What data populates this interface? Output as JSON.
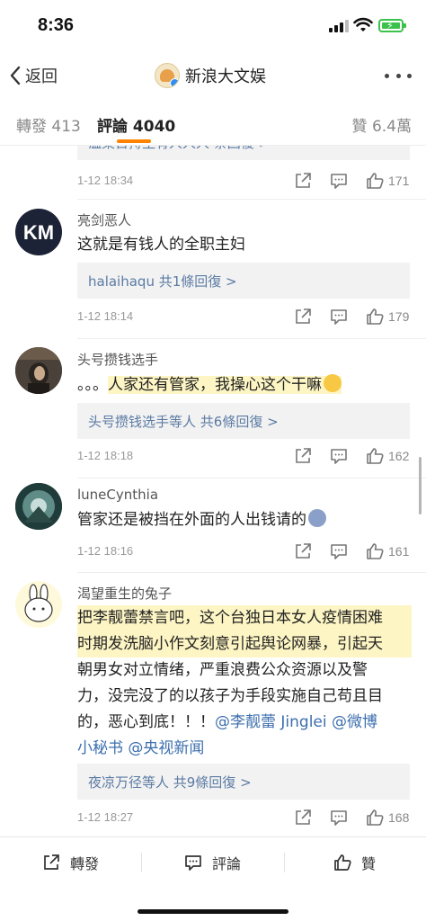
{
  "status": {
    "time": "8:36"
  },
  "nav": {
    "back_label": "返回",
    "title": "新浪大文娱"
  },
  "tabs": {
    "repost_label": "轉發",
    "repost_count": "413",
    "comment_label": "評論",
    "comment_count": "4040",
    "like_label": "贊",
    "like_count": "6.4萬"
  },
  "partial_reply": {
    "text": "温柔日持生有人人人 条回復 >"
  },
  "comments": [
    {
      "time": "1-12 18:34",
      "likes": "171"
    },
    {
      "username": "亮剑恶人",
      "text": "这就是有钱人的全职主妇",
      "reply_link": "halaihaqu",
      "reply_suffix": " 共1條回復 >",
      "time": "1-12 18:14",
      "likes": "179"
    },
    {
      "username": "头号攒钱选手",
      "text_plain": "。。。",
      "text_highlight": "人家还有管家，我操心这个干嘛",
      "reply_link": "头号攒钱选手",
      "reply_suffix": "等人 共6條回復 >",
      "time": "1-12 18:18",
      "likes": "162"
    },
    {
      "username": "luneCynthia",
      "text": "管家还是被挡在外面的人出钱请的",
      "time": "1-12 18:16",
      "likes": "161"
    },
    {
      "username": "渴望重生的兔子",
      "line1": "把李靓蕾禁言吧，这个台独日本女人疫情困难",
      "line2": "时期发洗脑小作文刻意引起舆论网暴，引起天",
      "line3": "朝男女对立情绪，严重浪费公众资源以及警",
      "line4_text": "力，没完没了的以孩子为手段实施自己苟且目",
      "line5_text": "的，恶心到底！！！",
      "mention1": "@李靓蕾 Jinglei",
      "mention2": "@微博",
      "mention3": "小秘书",
      "mention4": "@央视新闻",
      "reply_text": "夜凉万径等人 共9條回復 >",
      "time": "1-12 18:27",
      "likes": "168"
    }
  ],
  "bottom_bar": {
    "repost": "轉發",
    "comment": "評論",
    "like": "贊"
  },
  "colors": {
    "accent": "#ff8200",
    "link": "#5b7ba4",
    "highlight": "#fdf5c4"
  },
  "icons": [
    "back-chevron-icon",
    "more-icon",
    "share-icon",
    "comment-icon",
    "like-icon",
    "signal-icon",
    "wifi-icon",
    "battery-icon"
  ]
}
